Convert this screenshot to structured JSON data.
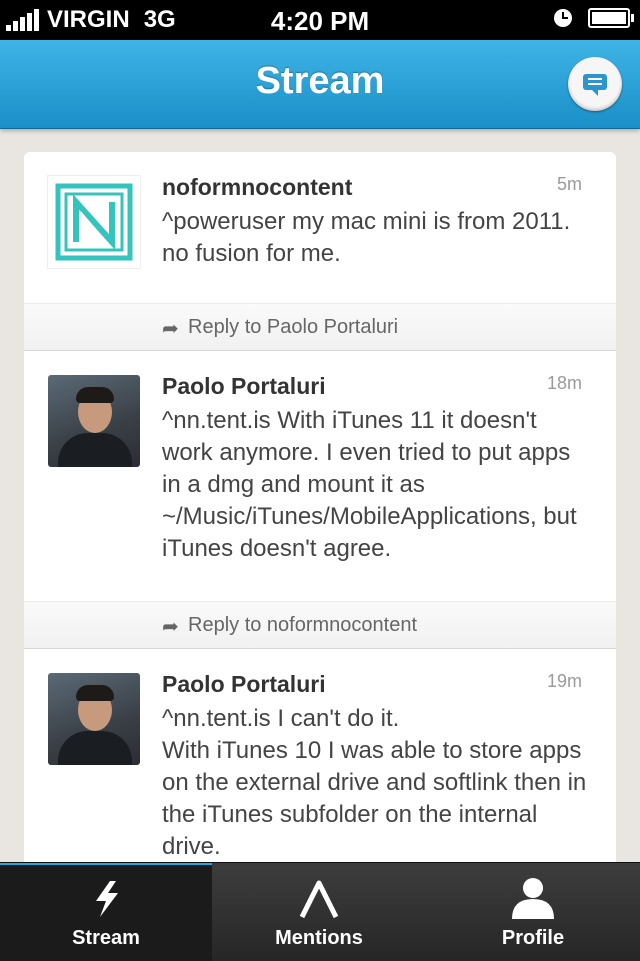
{
  "status_bar": {
    "carrier": "VIRGIN",
    "network": "3G",
    "time": "4:20 PM"
  },
  "header": {
    "title": "Stream",
    "compose_icon": "compose-icon"
  },
  "posts": [
    {
      "author": "noformnocontent",
      "time": "5m",
      "text": "^poweruser my mac mini is from 2011. no fusion for me.",
      "reply_label": "Reply to Paolo Portaluri"
    },
    {
      "author": "Paolo Portaluri",
      "time": "18m",
      "text": "^nn.tent.is With iTunes 11 it doesn't work anymore. I even tried to put apps in a dmg and mount it as ~/Music/iTunes/MobileApplications, but iTunes doesn't agree.",
      "reply_label": "Reply to noformnocontent"
    },
    {
      "author": "Paolo Portaluri",
      "time": "19m",
      "text": "^nn.tent.is I can't do it.\nWith iTunes 10 I was able to store apps on the external drive and softlink then in the iTunes subfolder on the internal drive."
    }
  ],
  "tabs": [
    {
      "label": "Stream",
      "icon": "lightning-icon",
      "active": true
    },
    {
      "label": "Mentions",
      "icon": "caret-icon",
      "active": false
    },
    {
      "label": "Profile",
      "icon": "person-icon",
      "active": false
    }
  ],
  "colors": {
    "accent": "#2aa3dc",
    "navbar": "#1a8fc8",
    "logo": "#35c3bd"
  }
}
